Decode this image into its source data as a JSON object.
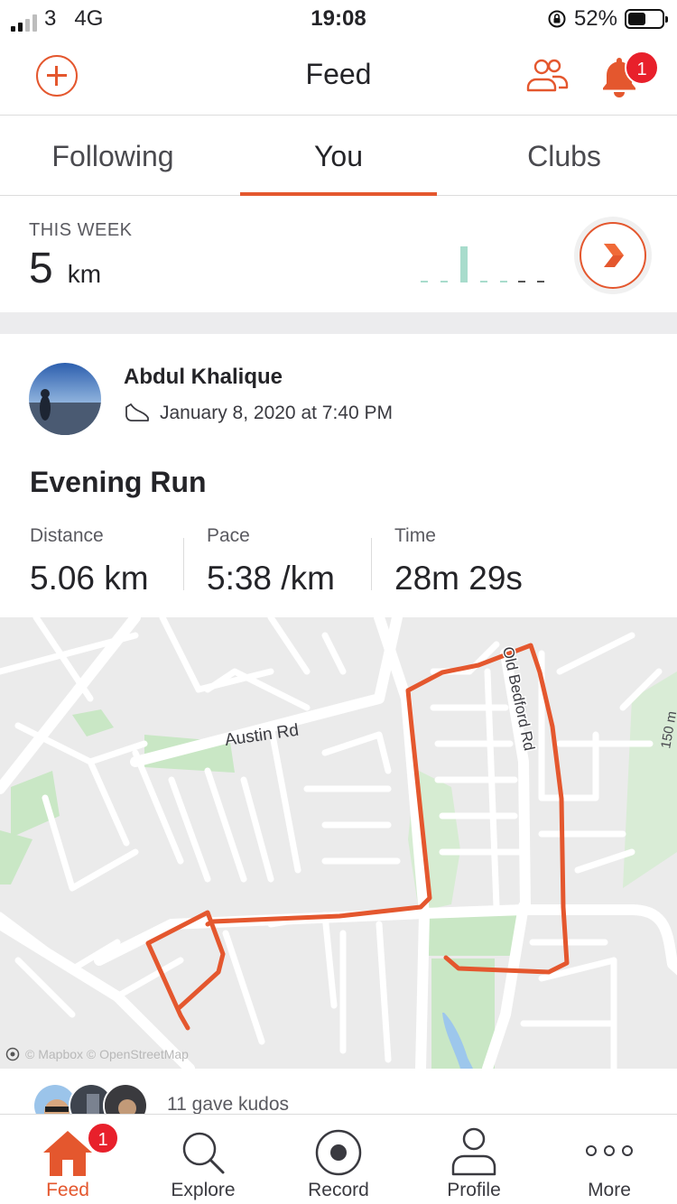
{
  "status_bar": {
    "carrier": "3",
    "network": "4G",
    "time": "19:08",
    "battery": "52%",
    "battery_level": 0.52
  },
  "header": {
    "title": "Feed",
    "notification_count": "1",
    "accent": "#e4572e"
  },
  "tabs": [
    {
      "label": "Following",
      "active": false
    },
    {
      "label": "You",
      "active": true
    },
    {
      "label": "Clubs",
      "active": false
    }
  ],
  "week": {
    "label": "THIS WEEK",
    "value": "5",
    "unit": "km"
  },
  "activity": {
    "athlete": "Abdul Khalique",
    "date": "January 8, 2020 at 7:40 PM",
    "title": "Evening Run",
    "stats": [
      {
        "label": "Distance",
        "value": "5.06 km"
      },
      {
        "label": "Pace",
        "value": "5:38 /km"
      },
      {
        "label": "Time",
        "value": "28m 29s"
      }
    ]
  },
  "map": {
    "roads": {
      "austin": "Austin Rd",
      "old_bedford": "Old Bedford Rd"
    },
    "elevation_label": "150 m",
    "attribution": "© Mapbox © OpenStreetMap",
    "route_color": "#e4572e"
  },
  "kudos": {
    "text": "11 gave kudos"
  },
  "nav": [
    {
      "label": "Feed",
      "icon": "home-icon",
      "active": true,
      "badge": "1"
    },
    {
      "label": "Explore",
      "icon": "search-icon",
      "active": false
    },
    {
      "label": "Record",
      "icon": "record-icon",
      "active": false
    },
    {
      "label": "Profile",
      "icon": "profile-icon",
      "active": false
    },
    {
      "label": "More",
      "icon": "more-icon",
      "active": false
    }
  ]
}
